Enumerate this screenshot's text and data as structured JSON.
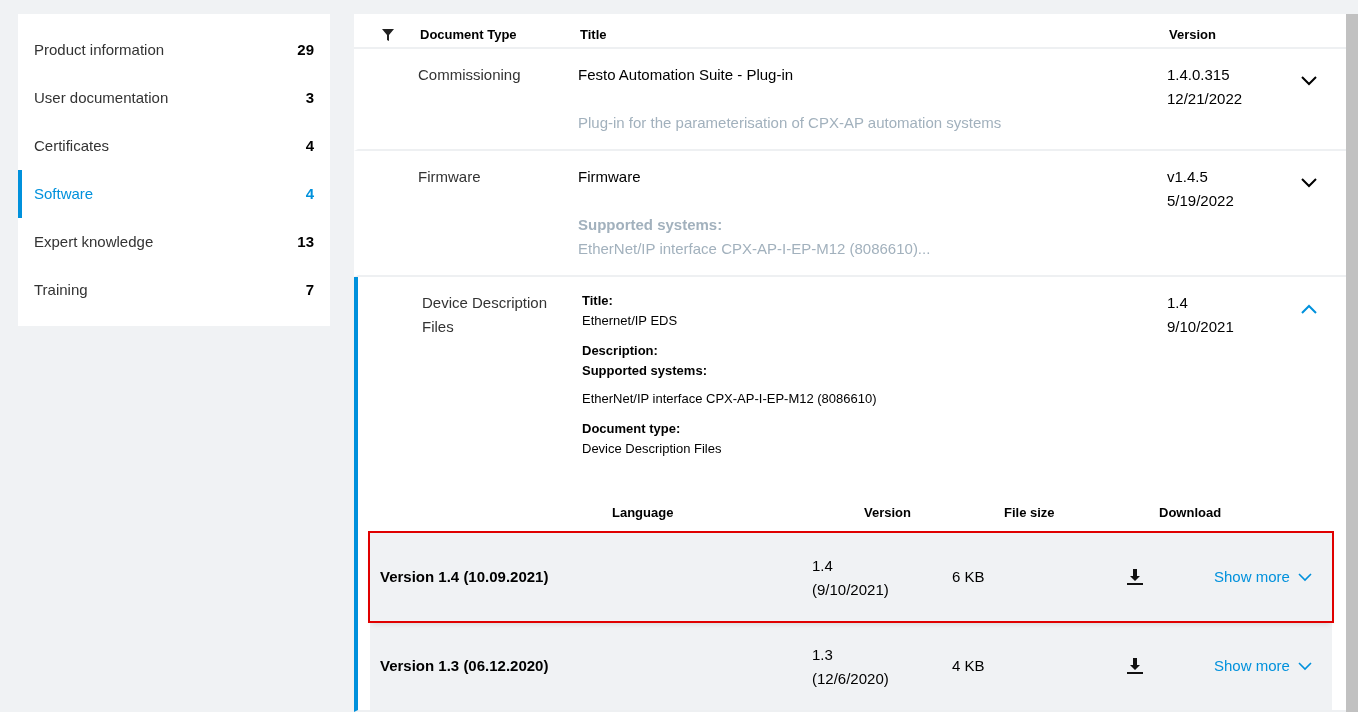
{
  "sidebar": {
    "items": [
      {
        "label": "Product information",
        "count": "29",
        "selected": false
      },
      {
        "label": "User documentation",
        "count": "3",
        "selected": false
      },
      {
        "label": "Certificates",
        "count": "4",
        "selected": false
      },
      {
        "label": "Software",
        "count": "4",
        "selected": true
      },
      {
        "label": "Expert knowledge",
        "count": "13",
        "selected": false
      },
      {
        "label": "Training",
        "count": "7",
        "selected": false
      }
    ]
  },
  "table": {
    "columns": [
      "Document Type",
      "Title",
      "Version"
    ],
    "rows": [
      {
        "kind": "summary",
        "expanded": false,
        "document_type": "Commissioning",
        "title": "Festo Automation Suite - Plug-in",
        "note": "Plug-in for the parameterisation of CPX-AP automation systems",
        "version": "1.4.0.315",
        "date": "12/21/2022"
      },
      {
        "kind": "summary",
        "expanded": false,
        "document_type": "Firmware",
        "title": "Firmware",
        "note_label": "Supported systems:",
        "note": "EtherNet/IP interface CPX-AP-I-EP-M12 (8086610)...",
        "version": "v1.4.5",
        "date": "5/19/2022"
      },
      {
        "kind": "detail",
        "expanded": true,
        "document_type": "Device Description Files",
        "version": "1.4",
        "date": "9/10/2021",
        "details": [
          {
            "label": "Title:",
            "value": "Ethernet/IP EDS"
          },
          {
            "label": "Description:"
          },
          {
            "label": "Supported systems:",
            "value": "EtherNet/IP interface CPX-AP-I-EP-M12 (8086610)"
          },
          {
            "label": "Document type:",
            "value": "Device Description Files"
          }
        ],
        "files": {
          "columns": [
            "Language",
            "Version",
            "File size",
            "Download"
          ],
          "rows": [
            {
              "name": "Version 1.4 (10.09.2021)",
              "version": "1.4",
              "date": "(9/10/2021)",
              "size": "6 KB",
              "link": "Show more",
              "highlighted": true
            },
            {
              "name": "Version 1.3 (06.12.2020)",
              "version": "1.3",
              "date": "(12/6/2020)",
              "size": "4 KB",
              "link": "Show more",
              "highlighted": false
            }
          ]
        }
      }
    ]
  }
}
